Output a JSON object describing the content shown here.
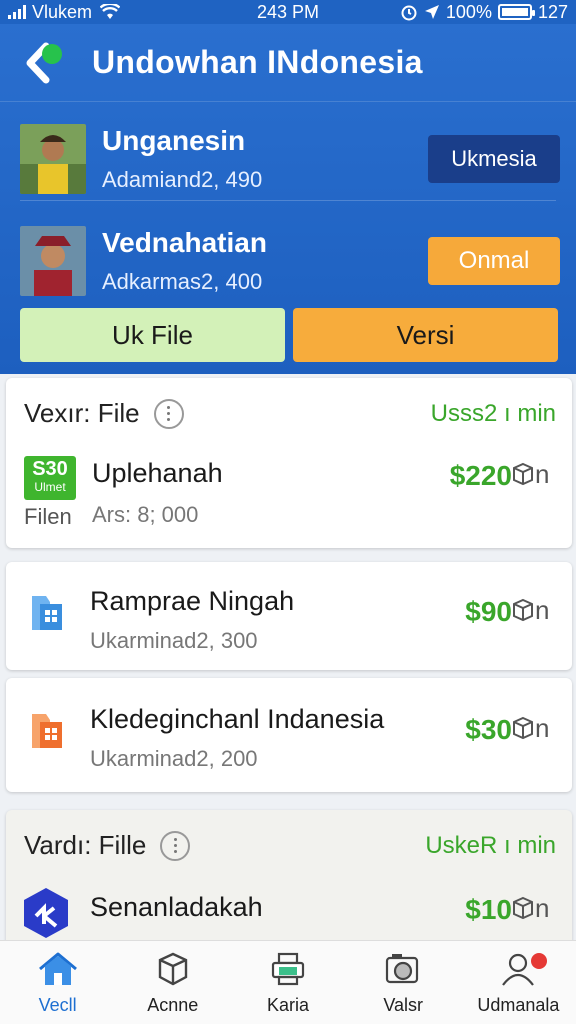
{
  "status_bar": {
    "carrier": "Vlukem",
    "time": "243 PM",
    "battery": "100%",
    "extra": "127"
  },
  "header": {
    "title": "Undowhan INdonesia"
  },
  "people": [
    {
      "name": "Unganesin",
      "sub": "Adamiand2, 490",
      "button": "Ukmesia"
    },
    {
      "name": "Vednahatian",
      "sub": "Adkarmas2, 400",
      "button": "Onmal"
    }
  ],
  "actions": {
    "left": "Uk File",
    "right": "Versi"
  },
  "section1": {
    "title": "Vexır: File",
    "tag": "Usss2 ı min",
    "badge": {
      "big": "S30",
      "small": "Ulmet"
    },
    "item": {
      "title": "Uplehanah",
      "sub": "Ars: 8; 000",
      "price": "$220"
    },
    "file_label": "Filen"
  },
  "card2": {
    "title": "Ramprae Ningah",
    "sub": "Ukarminad2, 300",
    "price": "$90"
  },
  "card3": {
    "title": "Kledeginchanl Indanesia",
    "sub": "Ukarminad2, 200",
    "price": "$30"
  },
  "section2": {
    "title": "Vardı: Fille",
    "tag": "UskeR ı min",
    "item": {
      "title": "Senanladakah",
      "price": "$10"
    }
  },
  "cart_suffix": "n",
  "tabs": [
    {
      "label": "Vecll",
      "icon": "home-icon"
    },
    {
      "label": "Acnne",
      "icon": "box-icon"
    },
    {
      "label": "Karia",
      "icon": "printer-icon"
    },
    {
      "label": "Valsr",
      "icon": "camera-icon"
    },
    {
      "label": "Udmanala",
      "icon": "profile-icon"
    }
  ],
  "colors": {
    "header": "#1d5fbf",
    "accent_green": "#3aa62b",
    "accent_orange": "#f6a93a",
    "navy": "#1a3e8a"
  }
}
